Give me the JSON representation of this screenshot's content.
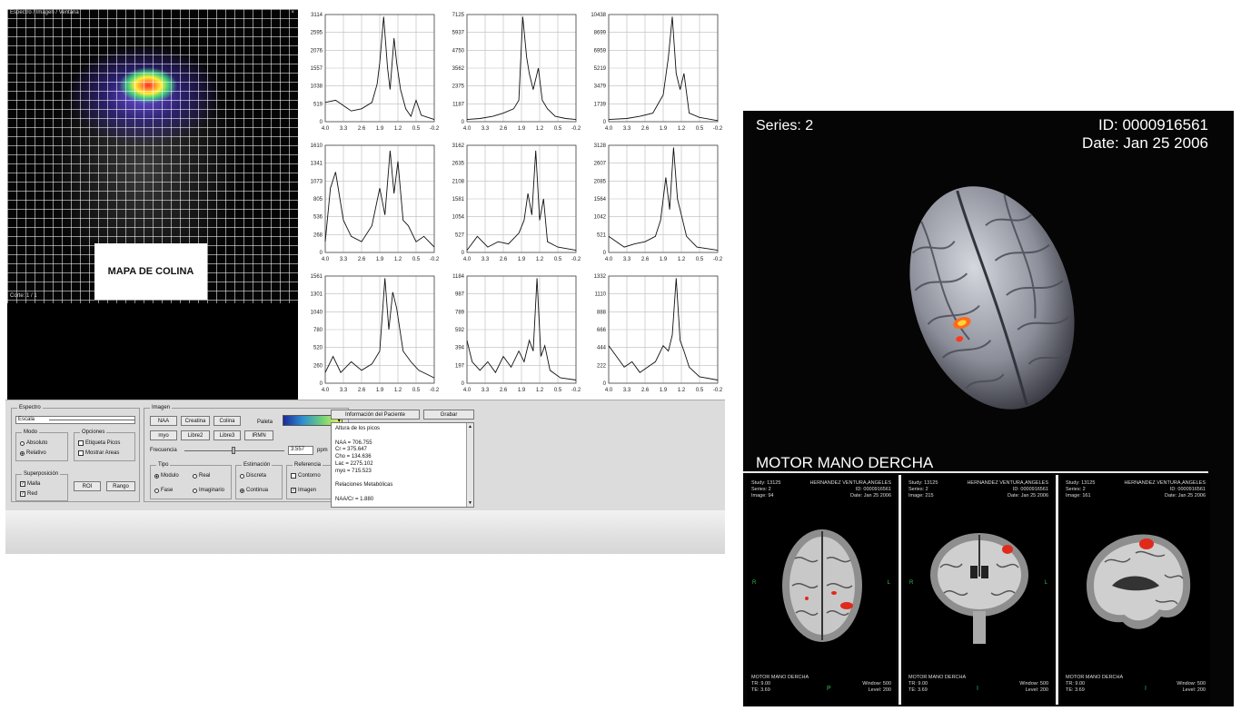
{
  "app": {
    "map": {
      "top_text": "Espectro / Imagen / Ventana",
      "top_right": "×",
      "bottom_text": "Corte: 1 / 1",
      "label": "MAPA DE COLINA"
    },
    "spectra": [
      {
        "yticks": [
          "3114",
          "2595",
          "2076",
          "1557",
          "1038",
          "519",
          "0"
        ],
        "trace": [
          [
            4.0,
            0.18
          ],
          [
            3.6,
            0.2
          ],
          [
            3.3,
            0.15
          ],
          [
            3.0,
            0.1
          ],
          [
            2.6,
            0.12
          ],
          [
            2.2,
            0.18
          ],
          [
            2.0,
            0.35
          ],
          [
            1.9,
            0.55
          ],
          [
            1.75,
            0.98
          ],
          [
            1.6,
            0.5
          ],
          [
            1.5,
            0.3
          ],
          [
            1.35,
            0.78
          ],
          [
            1.25,
            0.55
          ],
          [
            1.1,
            0.3
          ],
          [
            0.9,
            0.12
          ],
          [
            0.7,
            0.05
          ],
          [
            0.5,
            0.2
          ],
          [
            0.3,
            0.06
          ],
          [
            -0.2,
            0.02
          ]
        ]
      },
      {
        "yticks": [
          "7125",
          "5937",
          "4750",
          "3562",
          "2375",
          "1187",
          "0"
        ],
        "trace": [
          [
            4.0,
            0.02
          ],
          [
            3.5,
            0.03
          ],
          [
            3.0,
            0.05
          ],
          [
            2.6,
            0.08
          ],
          [
            2.2,
            0.12
          ],
          [
            2.0,
            0.2
          ],
          [
            1.85,
            0.98
          ],
          [
            1.7,
            0.6
          ],
          [
            1.6,
            0.45
          ],
          [
            1.45,
            0.3
          ],
          [
            1.25,
            0.5
          ],
          [
            1.1,
            0.2
          ],
          [
            0.9,
            0.12
          ],
          [
            0.6,
            0.05
          ],
          [
            0.2,
            0.03
          ],
          [
            -0.2,
            0.02
          ]
        ]
      },
      {
        "yticks": [
          "10438",
          "8699",
          "6959",
          "5219",
          "3479",
          "1739",
          "0"
        ],
        "trace": [
          [
            4.0,
            0.02
          ],
          [
            3.3,
            0.03
          ],
          [
            2.8,
            0.05
          ],
          [
            2.3,
            0.08
          ],
          [
            1.9,
            0.25
          ],
          [
            1.7,
            0.6
          ],
          [
            1.55,
            0.98
          ],
          [
            1.4,
            0.45
          ],
          [
            1.25,
            0.3
          ],
          [
            1.1,
            0.45
          ],
          [
            0.9,
            0.08
          ],
          [
            0.5,
            0.04
          ],
          [
            -0.2,
            0.01
          ]
        ]
      },
      {
        "yticks": [
          "1610",
          "1341",
          "1073",
          "805",
          "536",
          "268",
          "0"
        ],
        "trace": [
          [
            4.0,
            0.1
          ],
          [
            3.8,
            0.6
          ],
          [
            3.6,
            0.75
          ],
          [
            3.3,
            0.3
          ],
          [
            3.0,
            0.15
          ],
          [
            2.6,
            0.1
          ],
          [
            2.2,
            0.25
          ],
          [
            1.9,
            0.6
          ],
          [
            1.7,
            0.35
          ],
          [
            1.5,
            0.95
          ],
          [
            1.35,
            0.55
          ],
          [
            1.2,
            0.85
          ],
          [
            1.0,
            0.3
          ],
          [
            0.8,
            0.25
          ],
          [
            0.5,
            0.1
          ],
          [
            0.2,
            0.15
          ],
          [
            -0.2,
            0.05
          ]
        ]
      },
      {
        "yticks": [
          "3162",
          "2635",
          "2108",
          "1581",
          "1054",
          "527",
          "0"
        ],
        "trace": [
          [
            4.0,
            0.02
          ],
          [
            3.6,
            0.15
          ],
          [
            3.2,
            0.05
          ],
          [
            2.8,
            0.1
          ],
          [
            2.4,
            0.08
          ],
          [
            2.0,
            0.18
          ],
          [
            1.8,
            0.3
          ],
          [
            1.65,
            0.55
          ],
          [
            1.5,
            0.35
          ],
          [
            1.35,
            0.95
          ],
          [
            1.2,
            0.3
          ],
          [
            1.05,
            0.5
          ],
          [
            0.9,
            0.1
          ],
          [
            0.5,
            0.05
          ],
          [
            -0.2,
            0.02
          ]
        ]
      },
      {
        "yticks": [
          "3128",
          "2607",
          "2085",
          "1564",
          "1042",
          "521",
          "0"
        ],
        "trace": [
          [
            4.0,
            0.15
          ],
          [
            3.7,
            0.1
          ],
          [
            3.4,
            0.05
          ],
          [
            3.0,
            0.08
          ],
          [
            2.6,
            0.1
          ],
          [
            2.2,
            0.15
          ],
          [
            2.0,
            0.3
          ],
          [
            1.8,
            0.7
          ],
          [
            1.65,
            0.4
          ],
          [
            1.5,
            0.98
          ],
          [
            1.35,
            0.5
          ],
          [
            1.2,
            0.35
          ],
          [
            1.0,
            0.15
          ],
          [
            0.6,
            0.05
          ],
          [
            -0.2,
            0.02
          ]
        ]
      },
      {
        "yticks": [
          "1561",
          "1301",
          "1040",
          "780",
          "520",
          "260",
          "0"
        ],
        "trace": [
          [
            4.0,
            0.1
          ],
          [
            3.7,
            0.25
          ],
          [
            3.4,
            0.1
          ],
          [
            3.0,
            0.2
          ],
          [
            2.6,
            0.12
          ],
          [
            2.2,
            0.18
          ],
          [
            1.9,
            0.3
          ],
          [
            1.7,
            0.98
          ],
          [
            1.55,
            0.5
          ],
          [
            1.4,
            0.85
          ],
          [
            1.25,
            0.7
          ],
          [
            1.0,
            0.3
          ],
          [
            0.7,
            0.2
          ],
          [
            0.4,
            0.12
          ],
          [
            -0.2,
            0.05
          ]
        ]
      },
      {
        "yticks": [
          "1184",
          "987",
          "789",
          "592",
          "394",
          "197",
          "0"
        ],
        "trace": [
          [
            4.0,
            0.4
          ],
          [
            3.8,
            0.2
          ],
          [
            3.5,
            0.12
          ],
          [
            3.2,
            0.2
          ],
          [
            2.9,
            0.1
          ],
          [
            2.6,
            0.25
          ],
          [
            2.3,
            0.15
          ],
          [
            2.0,
            0.3
          ],
          [
            1.8,
            0.2
          ],
          [
            1.6,
            0.4
          ],
          [
            1.45,
            0.3
          ],
          [
            1.3,
            0.98
          ],
          [
            1.15,
            0.25
          ],
          [
            1.0,
            0.35
          ],
          [
            0.8,
            0.12
          ],
          [
            0.4,
            0.05
          ],
          [
            -0.2,
            0.03
          ]
        ]
      },
      {
        "yticks": [
          "1332",
          "1110",
          "888",
          "666",
          "444",
          "222",
          "0"
        ],
        "trace": [
          [
            4.0,
            0.35
          ],
          [
            3.7,
            0.25
          ],
          [
            3.4,
            0.15
          ],
          [
            3.1,
            0.2
          ],
          [
            2.8,
            0.1
          ],
          [
            2.5,
            0.15
          ],
          [
            2.2,
            0.2
          ],
          [
            1.9,
            0.35
          ],
          [
            1.7,
            0.3
          ],
          [
            1.55,
            0.45
          ],
          [
            1.4,
            0.98
          ],
          [
            1.25,
            0.4
          ],
          [
            1.1,
            0.3
          ],
          [
            0.9,
            0.15
          ],
          [
            0.5,
            0.06
          ],
          [
            -0.2,
            0.03
          ]
        ]
      }
    ],
    "xticks": [
      "4.0",
      "3.3",
      "2.6",
      "1.9",
      "1.2",
      "0.5",
      "-0.2"
    ],
    "panel": {
      "espectro": {
        "legend": "Espectro",
        "select": "Escala",
        "modo_legend": "Modo",
        "modo_options": [
          "Absoluto",
          "Relativo"
        ],
        "opciones_legend": "Opciones",
        "opciones_items": [
          "Etiqueta Picos",
          "Mostrar Areas"
        ],
        "super_legend": "Superposición",
        "super_items": [
          "Malla",
          "Red"
        ],
        "roi": "ROI",
        "rango": "Rango"
      },
      "imagen": {
        "legend": "Imagen",
        "buttons_row1": [
          "NAA",
          "Creatina",
          "Colina"
        ],
        "buttons_row2": [
          "myo",
          "Libre2",
          "Libre3",
          "IRMN"
        ],
        "paleta": "Paleta",
        "frecuencia": "Frecuencia",
        "freq_value": "3.557",
        "unit": "ppm",
        "tipo_legend": "Tipo",
        "tipo_options": [
          "Modulo",
          "Real",
          "Fase",
          "Imaginario"
        ],
        "est_legend": "Estimación",
        "est_options": [
          "Discreta",
          "Continua"
        ],
        "ref_legend": "Referencia",
        "ref_options": [
          "Contorno",
          "Imagen"
        ]
      },
      "info": {
        "btn_info": "Información del Paciente",
        "btn_grabar": "Grabar",
        "lines": [
          "Altura de los picos",
          "",
          "NAA = 706.755",
          "Cr = 375.647",
          "Cho = 134.636",
          "Lac = 2275.102",
          "myo = 715.523",
          "",
          "Relaciones Metabólicas",
          "",
          "NAA/Cr = 1.880"
        ]
      }
    }
  },
  "viewer": {
    "series": "Series: 2",
    "id": "ID: 0000916561",
    "date": "Date: Jan 25 2006",
    "caption": "MOTOR MANO DERCHA",
    "slices": [
      {
        "hdr": [
          "Study: 13125",
          "Series: 2",
          "Image: 94"
        ],
        "hdr_r": [
          "HERNANDEZ VENTURA,ANGELES",
          "ID: 0000916561",
          "Date: Jan 25 2006"
        ],
        "ftr": [
          "MOTOR MANO DERCHA",
          "TR: 9.00",
          "TE: 3.69"
        ],
        "ftr_r": [
          "Window: 500",
          "Level: 200"
        ],
        "left_mark": "R",
        "right_mark": "L",
        "bottom_mark": "P"
      },
      {
        "hdr": [
          "Study: 13125",
          "Series: 2",
          "Image: 215"
        ],
        "hdr_r": [
          "HERNANDEZ VENTURA,ANGELES",
          "ID: 0000916561",
          "Date: Jan 25 2006"
        ],
        "ftr": [
          "MOTOR MANO DERCHA",
          "TR: 9.00",
          "TE: 3.69"
        ],
        "ftr_r": [
          "Window: 500",
          "Level: 200"
        ],
        "left_mark": "R",
        "right_mark": "L",
        "bottom_mark": "I"
      },
      {
        "hdr": [
          "Study: 13125",
          "Series: 2",
          "Image: 161"
        ],
        "hdr_r": [
          "HERNANDEZ VENTURA,ANGELES",
          "ID: 0000916561",
          "Date: Jan 25 2006"
        ],
        "ftr": [
          "MOTOR MANO DERCHA",
          "TR: 9.00",
          "TE: 3.69"
        ],
        "ftr_r": [
          "Window: 500",
          "Level: 200"
        ],
        "left_mark": "",
        "right_mark": "",
        "bottom_mark": "I"
      }
    ]
  }
}
